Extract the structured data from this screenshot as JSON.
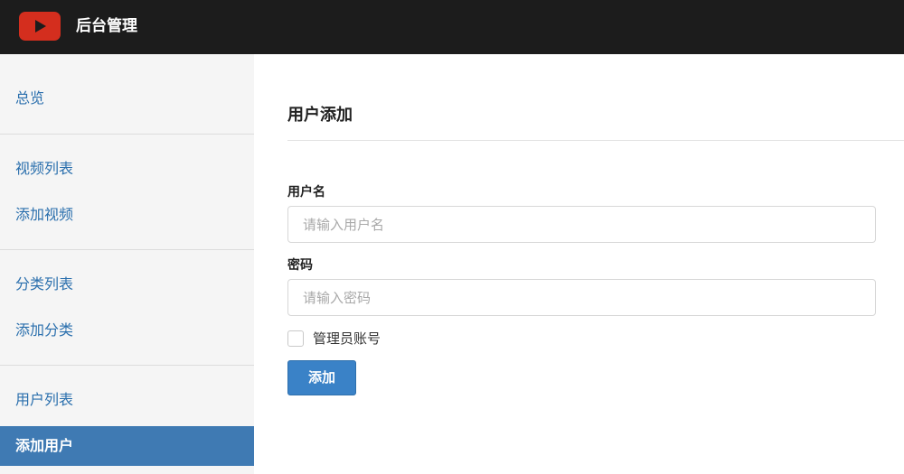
{
  "header": {
    "logo_icon": "youtube-play-icon",
    "title": "后台管理",
    "logo_color": "#d42e1e",
    "bar_color": "#1c1c1c"
  },
  "sidebar": {
    "items": [
      {
        "label": "总览",
        "active": false
      },
      {
        "label": "视频列表",
        "active": false
      },
      {
        "label": "添加视频",
        "active": false
      },
      {
        "label": "分类列表",
        "active": false
      },
      {
        "label": "添加分类",
        "active": false
      },
      {
        "label": "用户列表",
        "active": false
      },
      {
        "label": "添加用户",
        "active": true
      }
    ],
    "active_color": "#3f7ab3",
    "link_color": "#2a6fad"
  },
  "main": {
    "title": "用户添加",
    "form": {
      "username_label": "用户名",
      "username_placeholder": "请输入用户名",
      "username_value": "",
      "password_label": "密码",
      "password_placeholder": "请输入密码",
      "password_value": "",
      "admin_label": "管理员账号",
      "admin_checked": false,
      "submit_label": "添加"
    },
    "button_color": "#3a82c7"
  }
}
